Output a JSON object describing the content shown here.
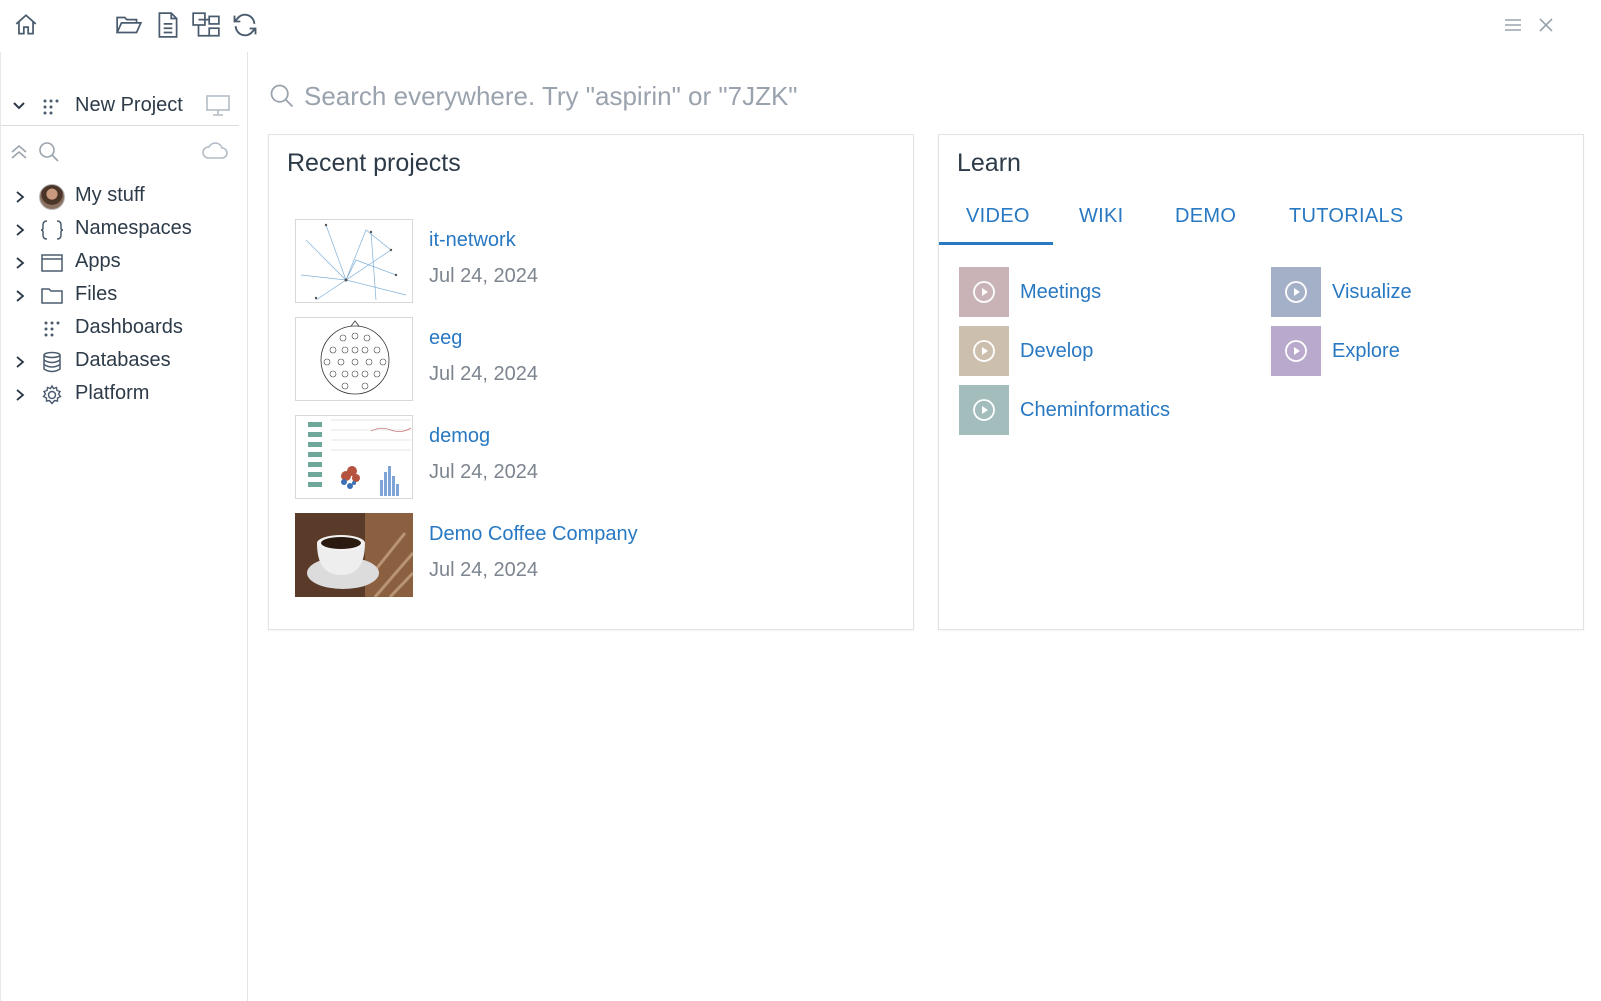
{
  "toolbar": {
    "icons": [
      "home-icon",
      "open-folder-icon",
      "document-icon",
      "tree-view-icon",
      "refresh-icon",
      "menu-icon",
      "close-icon"
    ]
  },
  "sidebar": {
    "project_label": "New Project",
    "items": [
      {
        "label": "My stuff",
        "icon": "avatar"
      },
      {
        "label": "Namespaces",
        "icon": "braces-icon"
      },
      {
        "label": "Apps",
        "icon": "window-icon"
      },
      {
        "label": "Files",
        "icon": "folder-icon"
      },
      {
        "label": "Dashboards",
        "icon": "grid-dots-icon"
      },
      {
        "label": "Databases",
        "icon": "database-icon"
      },
      {
        "label": "Platform",
        "icon": "gear-icon"
      }
    ]
  },
  "search": {
    "placeholder": "Search everywhere. Try \"aspirin\" or \"7JZK\""
  },
  "recent": {
    "title": "Recent projects",
    "projects": [
      {
        "name": "it-network",
        "date": "Jul 24, 2024"
      },
      {
        "name": "eeg",
        "date": "Jul 24, 2024"
      },
      {
        "name": "demog",
        "date": "Jul 24, 2024"
      },
      {
        "name": "Demo Coffee Company",
        "date": "Jul 24, 2024"
      }
    ]
  },
  "learn": {
    "title": "Learn",
    "tabs": [
      "VIDEO",
      "WIKI",
      "DEMO",
      "TUTORIALS"
    ],
    "active_tab": "VIDEO",
    "videos": [
      {
        "label": "Meetings",
        "color": "#c9b3b6"
      },
      {
        "label": "Visualize",
        "color": "#a4afc8"
      },
      {
        "label": "Develop",
        "color": "#cdbfae"
      },
      {
        "label": "Explore",
        "color": "#b8a9cd"
      },
      {
        "label": "Cheminformatics",
        "color": "#a3bdbc"
      }
    ]
  },
  "colors": {
    "accent": "#2878c2",
    "text": "#2d3a48",
    "muted": "#7c858f"
  }
}
